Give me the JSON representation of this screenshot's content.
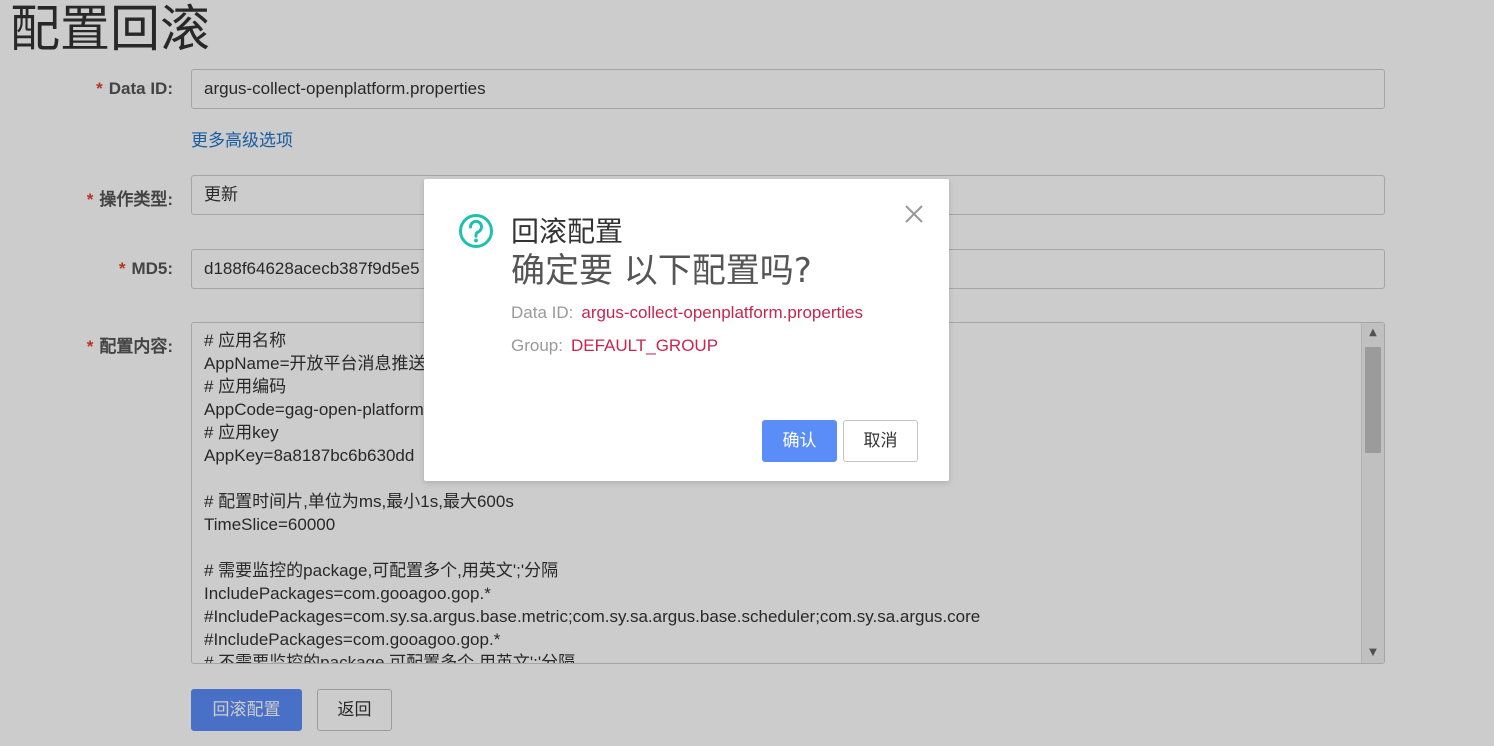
{
  "page": {
    "title": "配置回滚"
  },
  "form": {
    "required_mark": "*",
    "data_id": {
      "label": "Data ID:",
      "value": "argus-collect-openplatform.properties"
    },
    "advanced_link": "更多高级选项",
    "op_type": {
      "label": "操作类型:",
      "value": "更新"
    },
    "md5": {
      "label": "MD5:",
      "value": "d188f64628acecb387f9d5e5"
    },
    "content": {
      "label": "配置内容:",
      "lines": [
        "# 应用名称",
        "AppName=开放平台消息推送",
        "# 应用编码",
        "AppCode=gag-open-platform",
        "# 应用key",
        "AppKey=8a8187bc6b630dd",
        "",
        "# 配置时间片,单位为ms,最小1s,最大600s",
        "TimeSlice=60000",
        "",
        "# 需要监控的package,可配置多个,用英文';'分隔",
        "IncludePackages=com.gooagoo.gop.*",
        "#IncludePackages=com.sy.sa.argus.base.metric;com.sy.sa.argus.base.scheduler;com.sy.sa.argus.core",
        "#IncludePackages=com.gooagoo.gop.*",
        "# 不需要监控的package,可配置多个,用英文';'分隔"
      ]
    },
    "scroll_up_glyph": "▲",
    "scroll_down_glyph": "▼"
  },
  "actions": {
    "rollback_button": "回滚配置",
    "back_button": "返回"
  },
  "dialog": {
    "title": "回滚配置",
    "message": "确定要 以下配置吗?",
    "data_id": {
      "label": "Data ID:",
      "value": "argus-collect-openplatform.properties"
    },
    "group": {
      "label": "Group:",
      "value": "DEFAULT_GROUP"
    },
    "confirm_button": "确认",
    "cancel_button": "取消",
    "icon": "help-circle-icon",
    "close_icon": "close-icon"
  },
  "colors": {
    "primary": "#5a8df8",
    "link": "#1f73c9",
    "required": "#e4402f",
    "highlight": "#c7254e",
    "help_icon": "#1fc0b0"
  }
}
